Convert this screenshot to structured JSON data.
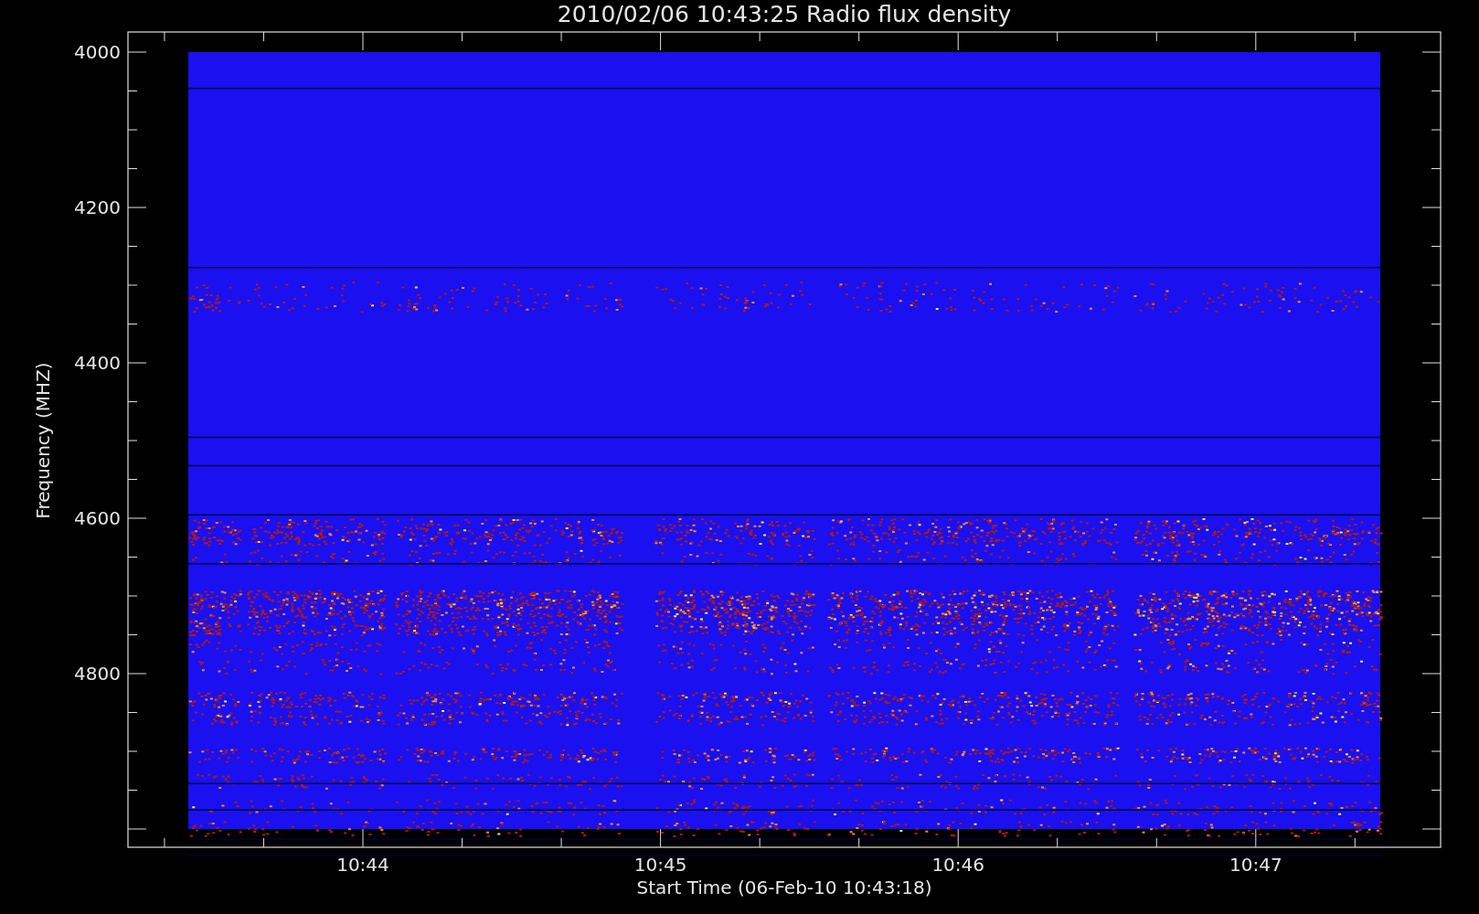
{
  "title": "2010/02/06 10:43:25 Radio flux density",
  "y_axis": {
    "title": "Frequency (MHZ)",
    "tick_labels": [
      "4000",
      "4200",
      "4400",
      "4600",
      "4800"
    ]
  },
  "x_axis": {
    "title": "Start Time (06-Feb-10 10:43:18)",
    "tick_labels": [
      "10:44",
      "10:45",
      "10:46",
      "10:47"
    ]
  }
}
